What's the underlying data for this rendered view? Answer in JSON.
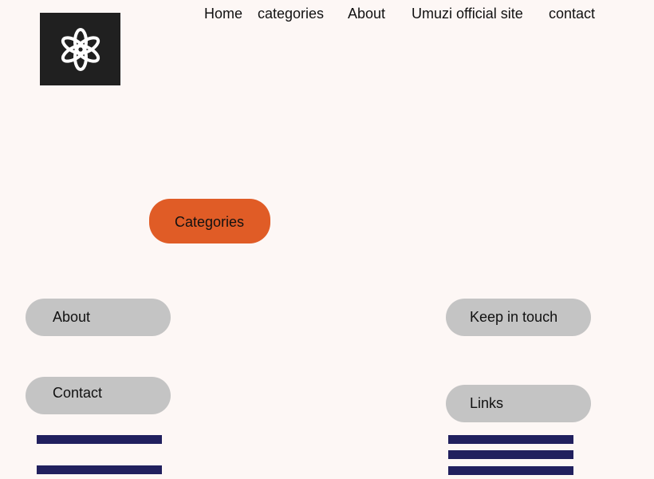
{
  "nav": {
    "home": "Home",
    "categories": "categories",
    "about": "About",
    "official_site": "Umuzi official site",
    "contact": "contact"
  },
  "logo": {
    "icon": "knot-icon",
    "color": "#202020"
  },
  "hero": {
    "categories_button": "Categories",
    "accent": "#e05c26"
  },
  "footer": {
    "about": "About",
    "contact": "Contact",
    "keep_in_touch": "Keep in touch",
    "links": "Links",
    "pill_color": "#c4c4c4",
    "bar_color": "#21205e"
  }
}
